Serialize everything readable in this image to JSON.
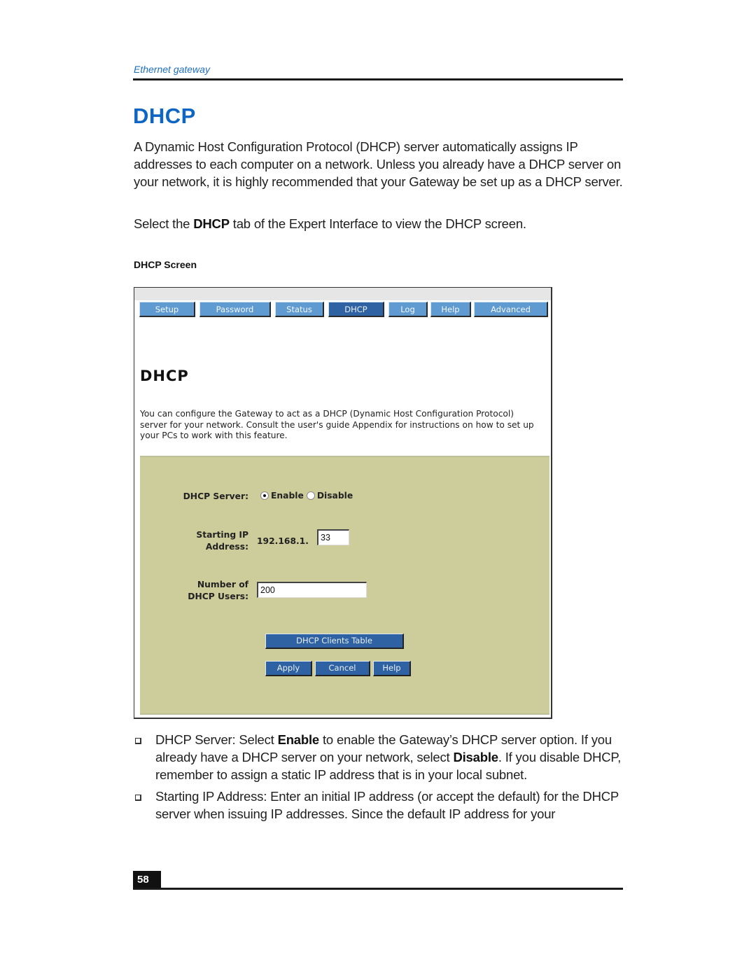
{
  "header": {
    "running_head": "Ethernet gateway"
  },
  "section": {
    "title": "DHCP",
    "para1": "A Dynamic Host Configuration Protocol (DHCP) server automatically assigns IP addresses to each computer on a network. Unless you already have a DHCP server on your network, it is highly recommended that your Gateway be set up as a DHCP server.",
    "para2_pre": "Select the ",
    "para2_bold": "DHCP",
    "para2_post": " tab of the Expert Interface to view the DHCP screen.",
    "figure_caption": "DHCP Screen"
  },
  "screenshot": {
    "tabs": [
      {
        "label": "Setup",
        "active": false
      },
      {
        "label": "Password",
        "active": false
      },
      {
        "label": "Status",
        "active": false
      },
      {
        "label": "DHCP",
        "active": true
      },
      {
        "label": "Log",
        "active": false
      },
      {
        "label": "Help",
        "active": false
      },
      {
        "label": "Advanced",
        "active": false
      }
    ],
    "title": "DHCP",
    "description": "You can configure the Gateway to act as a DHCP (Dynamic Host Configuration Protocol) server for your network. Consult the user's guide Appendix for instructions on how to set up your PCs to work with this feature.",
    "form": {
      "dhcp_server_label": "DHCP Server:",
      "enable_label": "Enable",
      "disable_label": "Disable",
      "selected": "Enable",
      "starting_ip_label_1": "Starting IP",
      "starting_ip_label_2": "Address:",
      "ip_prefix": "192.168.1.",
      "starting_ip_value": "33",
      "num_users_label_1": "Number of",
      "num_users_label_2": "DHCP Users:",
      "num_users_value": "200"
    },
    "buttons": {
      "clients_table": "DHCP Clients Table",
      "apply": "Apply",
      "cancel": "Cancel",
      "help": "Help"
    }
  },
  "bullets": [
    {
      "pre": "DHCP Server:  Select ",
      "b1": "Enable",
      "mid": " to enable the Gateway’s DHCP server option. If you already have a DHCP server on your network, select ",
      "b2": "Disable",
      "post": ". If you disable DHCP, remember to assign a static IP address that is in your local subnet."
    },
    {
      "text": "Starting IP Address:  Enter an initial IP address (or accept the default) for the DHCP server when issuing IP addresses. Since the default IP address for your"
    }
  ],
  "footer": {
    "page_number": "58"
  },
  "colors": {
    "heading_blue": "#0e66c4",
    "tab_blue": "#5f9bd0",
    "active_tab_blue": "#2f62a2",
    "panel_khaki": "#cdcd9c"
  }
}
